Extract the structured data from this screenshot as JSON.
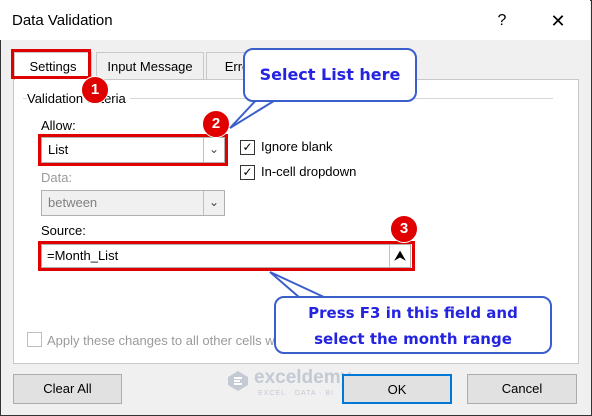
{
  "dialog": {
    "title": "Data Validation",
    "help_glyph": "?",
    "close_glyph": "✕"
  },
  "tabs": [
    {
      "label": "Settings",
      "active": true
    },
    {
      "label": "Input Message",
      "active": false
    },
    {
      "label": "Erro",
      "active": false
    }
  ],
  "settings": {
    "group_label": "Validation criteria",
    "allow_label": "Allow:",
    "allow_value": "List",
    "data_label": "Data:",
    "data_value": "between",
    "ignore_blank_label": "Ignore blank",
    "ignore_blank_checked": true,
    "incell_dropdown_label": "In-cell dropdown",
    "incell_dropdown_checked": true,
    "source_label": "Source:",
    "source_value": "=Month_List",
    "apply_all_label": "Apply these changes to all other cells w",
    "apply_all_checked": false
  },
  "buttons": {
    "clear_all": "Clear All",
    "ok": "OK",
    "cancel": "Cancel"
  },
  "annotations": {
    "badge1": "1",
    "badge2": "2",
    "badge3": "3",
    "callout1": "Select List here",
    "callout2_line1": "Press F3 in this field and",
    "callout2_line2": "select the month range",
    "highlight_color": "#e00000",
    "callout_color": "#2323e0"
  },
  "watermark": {
    "name": "exceldemy",
    "tagline": "EXCEL · DATA · BI"
  },
  "icons": {
    "dropdown": "chevron-down-icon",
    "range_picker": "upload-arrow-icon",
    "checkmark": "check-icon"
  }
}
